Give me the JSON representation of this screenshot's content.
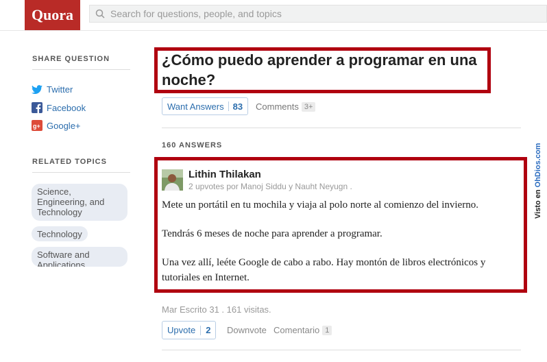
{
  "header": {
    "logo": "Quora",
    "search_placeholder": "Search for questions, people, and topics"
  },
  "sidebar": {
    "share_heading": "SHARE QUESTION",
    "share_items": [
      {
        "label": "Twitter",
        "icon": "twitter-icon",
        "color": "#1da1f2"
      },
      {
        "label": "Facebook",
        "icon": "facebook-icon",
        "color": "#3b5998"
      },
      {
        "label": "Google+",
        "icon": "google-plus-icon",
        "color": "#dd4b39"
      }
    ],
    "topics_heading": "RELATED TOPICS",
    "topics": [
      "Science, Engineering, and Technology",
      "Technology",
      "Software and Applications"
    ]
  },
  "question": {
    "title": "¿Cómo puedo aprender a programar en una noche?",
    "want_answers_label": "Want Answers",
    "want_answers_count": "83",
    "comments_label": "Comments",
    "comments_count": "3+"
  },
  "answers": {
    "count_label": "160 ANSWERS",
    "first": {
      "author": "Lithin Thilakan",
      "upvoters": "2 upvotes por Manoj Siddu y Nauht Neyugn .",
      "paragraphs": [
        "Mete un portátil en tu mochila y viaja al polo norte al comienzo del invierno.",
        "Tendrás 6 meses de noche para aprender a programar.",
        "Una vez allí, leéte Google de cabo a rabo. Hay montón de libros electrónicos y tutoriales en Internet."
      ],
      "meta": "Mar Escrito 31 . 161 visitas.",
      "upvote_label": "Upvote",
      "upvote_count": "2",
      "downvote_label": "Downvote",
      "comment_label": "Comentario",
      "comment_count": "1"
    }
  },
  "watermark": {
    "prefix": "Visto en ",
    "brand": "OhDios.com"
  },
  "colors": {
    "brand": "#b92b27",
    "highlight_border": "#b0000f",
    "link": "#2b6dad"
  }
}
